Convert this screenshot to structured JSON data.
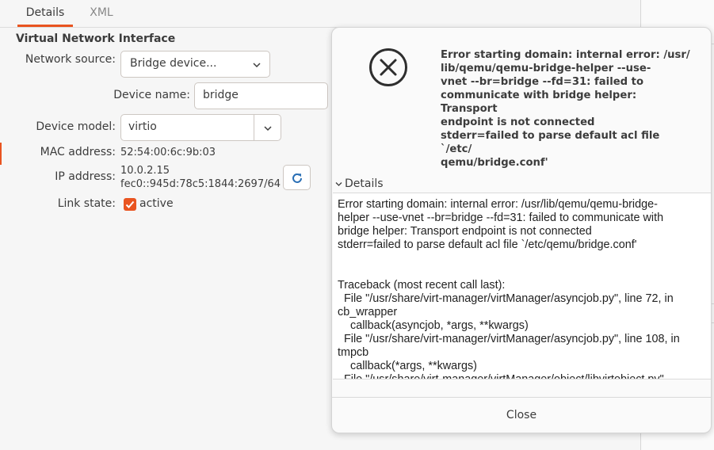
{
  "tabs": [
    {
      "label": "Details"
    },
    {
      "label": "XML"
    }
  ],
  "section_title": "Virtual Network Interface",
  "form": {
    "network_source_label": "Network source:",
    "network_source_value": "Bridge device...",
    "device_name_label": "Device name:",
    "device_name_value": "bridge",
    "device_model_label": "Device model:",
    "device_model_value": "virtio",
    "mac_label": "MAC address:",
    "mac_value": "52:54:00:6c:9b:03",
    "ip_label": "IP address:",
    "ip_v4": "10.0.2.15",
    "ip_v6": "fec0::945d:78c5:1844:2697/64",
    "link_label": "Link state:",
    "link_value": "active",
    "link_checked": true
  },
  "dialog": {
    "icon": "error-circle-x-icon",
    "primary_text": "Error starting domain: internal error: /usr/\nlib/qemu/qemu-bridge-helper --use-\nvnet --br=bridge --fd=31: failed to\ncommunicate with bridge helper: Transport\nendpoint is not connected\nstderr=failed to parse default acl file `/etc/\nqemu/bridge.conf'",
    "details_label": "Details",
    "details_text": "Error starting domain: internal error: /usr/lib/qemu/qemu-bridge-\nhelper --use-vnet --br=bridge --fd=31: failed to communicate with\nbridge helper: Transport endpoint is not connected\nstderr=failed to parse default acl file `/etc/qemu/bridge.conf'\n\n\nTraceback (most recent call last):\n  File \"/usr/share/virt-manager/virtManager/asyncjob.py\", line 72, in\ncb_wrapper\n    callback(asyncjob, *args, **kwargs)\n  File \"/usr/share/virt-manager/virtManager/asyncjob.py\", line 108, in\ntmpcb\n    callback(*args, **kwargs)\n  File \"/usr/share/virt-manager/virtManager/object/libvirtobject.py\"",
    "close_label": "Close"
  },
  "colors": {
    "accent": "#e95420",
    "refresh_icon": "#2a6fb5"
  }
}
